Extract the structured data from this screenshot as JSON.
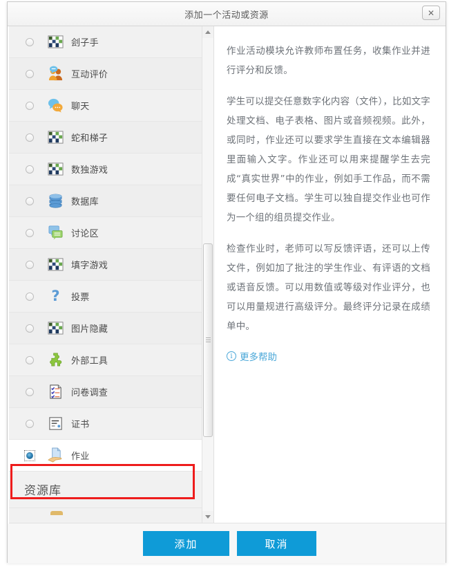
{
  "dialog": {
    "title": "添加一个活动或资源",
    "close_label": "✕",
    "close_icon": "close-icon"
  },
  "activity_list": {
    "rows": [
      {
        "label": "刽子手",
        "icon": "puzzle-grid-icon",
        "selected": false
      },
      {
        "label": "互动评价",
        "icon": "two-people-icon",
        "selected": false
      },
      {
        "label": "聊天",
        "icon": "chat-bubbles-icon",
        "selected": false
      },
      {
        "label": "蛇和梯子",
        "icon": "puzzle-grid-icon",
        "selected": false
      },
      {
        "label": "数独游戏",
        "icon": "puzzle-grid-icon",
        "selected": false
      },
      {
        "label": "数据库",
        "icon": "database-icon",
        "selected": false
      },
      {
        "label": "讨论区",
        "icon": "forum-bubbles-icon",
        "selected": false
      },
      {
        "label": "填字游戏",
        "icon": "puzzle-grid-icon",
        "selected": false
      },
      {
        "label": "投票",
        "icon": "question-mark-icon",
        "selected": false
      },
      {
        "label": "图片隐藏",
        "icon": "puzzle-grid-icon",
        "selected": false
      },
      {
        "label": "外部工具",
        "icon": "puzzle-piece-icon",
        "selected": false
      },
      {
        "label": "问卷调查",
        "icon": "checklist-page-icon",
        "selected": false
      },
      {
        "label": "证书",
        "icon": "certificate-icon",
        "selected": false
      },
      {
        "label": "作业",
        "icon": "assignment-hand-icon",
        "selected": true
      }
    ],
    "section_header": "资源库"
  },
  "description": {
    "paragraphs": [
      "作业活动模块允许教师布置任务，收集作业并进行评分和反馈。",
      "学生可以提交任意数字化内容（文件），比如文字处理文档、电子表格、图片或音频视频。此外，或同时，作业还可以要求学生直接在文本编辑器里面输入文字。作业还可以用来提醒学生去完成“真实世界”中的作业，例如手工作品，而不需要任何电子文档。学生可以独自提交作业也可作为一个组的组员提交作业。",
      "检查作业时，老师可以写反馈评语，还可以上传文件，例如加了批注的学生作业、有评语的文档或语音反馈。可以用数值或等级对作业评分，也可以用量规进行高级评分。最终评分记录在成绩单中。"
    ],
    "more_help": "更多帮助",
    "more_help_icon": "info-circle-icon"
  },
  "footer": {
    "add_label": "添加",
    "cancel_label": "取消"
  },
  "scrollbar": {
    "up_icon": "scroll-up-arrow-icon",
    "down_icon": "scroll-down-arrow-icon"
  },
  "colors": {
    "button_blue": "#0f9bd7",
    "link_blue": "#49a7d8",
    "highlight_red": "#ee1c1c",
    "panel_gray": "#f1f1f1",
    "text_gray": "#6d7278"
  }
}
